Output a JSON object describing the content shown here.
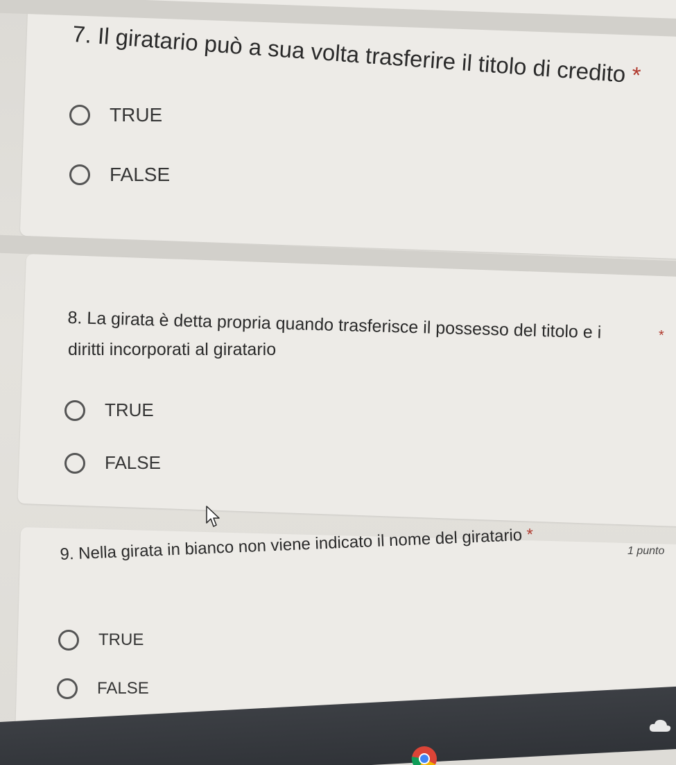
{
  "questions": [
    {
      "number": "7.",
      "text": "Il giratario può a sua volta trasferire il titolo di credito",
      "required_mark": "*",
      "options": [
        "TRUE",
        "FALSE"
      ]
    },
    {
      "number": "8.",
      "text_line1": "La girata è detta propria quando trasferisce il possesso del titolo e i",
      "text_line2": "diritti incorporati al giratario",
      "required_mark": "*",
      "options": [
        "TRUE",
        "FALSE"
      ]
    },
    {
      "number": "9.",
      "text": "Nella girata in bianco non viene indicato il nome del giratario",
      "required_mark": "*",
      "points": "1 punto",
      "options": [
        "TRUE",
        "FALSE"
      ]
    }
  ],
  "icons": {
    "cursor": "mouse-pointer-icon",
    "cloud": "cloud-icon",
    "chrome": "chrome-icon"
  },
  "colors": {
    "required": "#b0392d",
    "background": "#dcdad5",
    "taskbar": "#303338"
  }
}
